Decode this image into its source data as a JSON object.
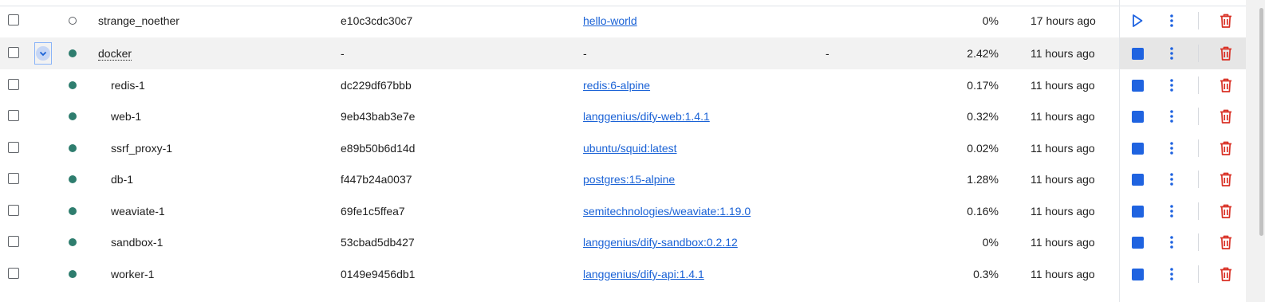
{
  "colors": {
    "link": "#1a62d6",
    "running": "#2e7d6e",
    "stop": "#1f63e0",
    "delete": "#d93025"
  },
  "rows": [
    {
      "name": "strange_noether",
      "id": "e10c3cdc30c7",
      "image": "hello-world",
      "port": "",
      "cpu": "0%",
      "started": "17 hours ago",
      "status": "stopped",
      "action": "start-icon",
      "kind": "container"
    },
    {
      "name": "docker",
      "id": "-",
      "image": "-",
      "port": "-",
      "cpu": "2.42%",
      "started": "11 hours ago",
      "status": "running",
      "action": "stop-icon",
      "kind": "group",
      "expanded": true
    },
    {
      "name": "redis-1",
      "id": "dc229df67bbb",
      "image": "redis:6-alpine",
      "port": "",
      "cpu": "0.17%",
      "started": "11 hours ago",
      "status": "running",
      "action": "stop-icon",
      "kind": "child"
    },
    {
      "name": "web-1",
      "id": "9eb43bab3e7e",
      "image": "langgenius/dify-web:1.4.1",
      "port": "",
      "cpu": "0.32%",
      "started": "11 hours ago",
      "status": "running",
      "action": "stop-icon",
      "kind": "child"
    },
    {
      "name": "ssrf_proxy-1",
      "id": "e89b50b6d14d",
      "image": "ubuntu/squid:latest",
      "port": "",
      "cpu": "0.02%",
      "started": "11 hours ago",
      "status": "running",
      "action": "stop-icon",
      "kind": "child"
    },
    {
      "name": "db-1",
      "id": "f447b24a0037",
      "image": "postgres:15-alpine",
      "port": "",
      "cpu": "1.28%",
      "started": "11 hours ago",
      "status": "running",
      "action": "stop-icon",
      "kind": "child"
    },
    {
      "name": "weaviate-1",
      "id": "69fe1c5ffea7",
      "image": "semitechnologies/weaviate:1.19.0",
      "port": "",
      "cpu": "0.16%",
      "started": "11 hours ago",
      "status": "running",
      "action": "stop-icon",
      "kind": "child"
    },
    {
      "name": "sandbox-1",
      "id": "53cbad5db427",
      "image": "langgenius/dify-sandbox:0.2.12",
      "port": "",
      "cpu": "0%",
      "started": "11 hours ago",
      "status": "running",
      "action": "stop-icon",
      "kind": "child"
    },
    {
      "name": "worker-1",
      "id": "0149e9456db1",
      "image": "langgenius/dify-api:1.4.1",
      "port": "",
      "cpu": "0.3%",
      "started": "11 hours ago",
      "status": "running",
      "action": "stop-icon",
      "kind": "child"
    }
  ]
}
